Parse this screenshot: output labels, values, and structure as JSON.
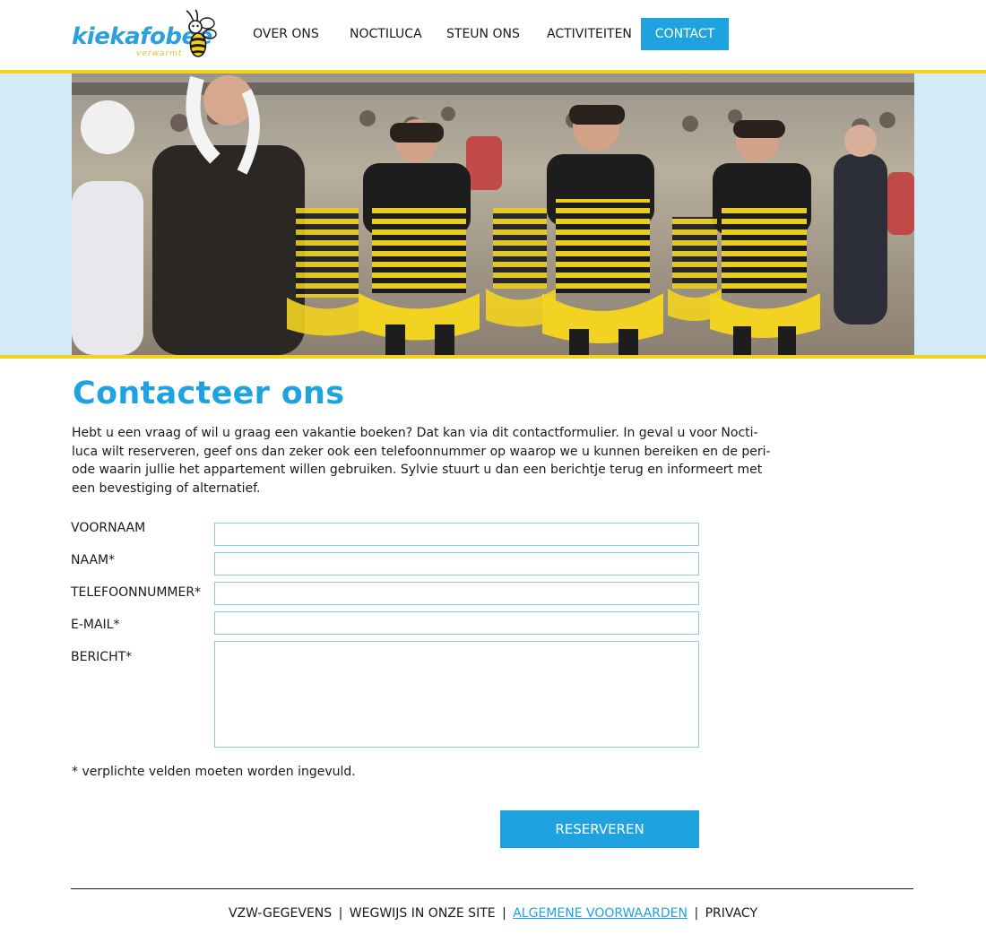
{
  "header": {
    "logo": {
      "name": "kiekafobee",
      "tagline": "verwarmt"
    },
    "nav": {
      "over_ons": "OVER ONS",
      "nocti_luca": "NOCTILUCA",
      "steun_ons": "STEUN ONS",
      "activiteiten": "ACTIVITEITEN",
      "contact": "CONTACT"
    }
  },
  "colors": {
    "accent_blue": "#1fa3e0",
    "accent_yellow": "#f3d21c",
    "banner_background": "#d3ebf7",
    "input_border": "#8dcbe3"
  },
  "main": {
    "title": "Contacteer ons",
    "intro_lines": [
      "Hebt u een vraag of wil u graag een vakantie boeken? Dat kan via dit contactformulier.  In geval u voor Nocti-",
      "luca wilt reserveren, geef ons dan zeker ook een telefoonnummer op waarop we u kunnen bereiken en de peri-",
      "ode waarin jullie het appartement willen gebruiken. Sylvie stuurt u dan een berichtje terug en informeert met",
      "een bevestiging of alternatief."
    ],
    "form": {
      "voornaam_label": "VOORNAAM",
      "voornaam_value": "",
      "naam_label": "NAAM*",
      "naam_value": "",
      "telefoon_label": "TELEFOONNUMMER*",
      "telefoon_value": "",
      "email_label": "E-MAIL*",
      "email_value": "",
      "bericht_label": "BERICHT*",
      "bericht_value": "",
      "required_note": "* verplichte velden moeten worden ingevuld.",
      "submit_label": "RESERVEREN"
    }
  },
  "footer": {
    "links": {
      "vzw": "VZW-GEGEVENS",
      "wegwijs": "WEGWIJS IN ONZE SITE",
      "voorwaarden": "ALGEMENE VOORWAARDEN",
      "privacy": "PRIVACY"
    },
    "separator": "|"
  }
}
